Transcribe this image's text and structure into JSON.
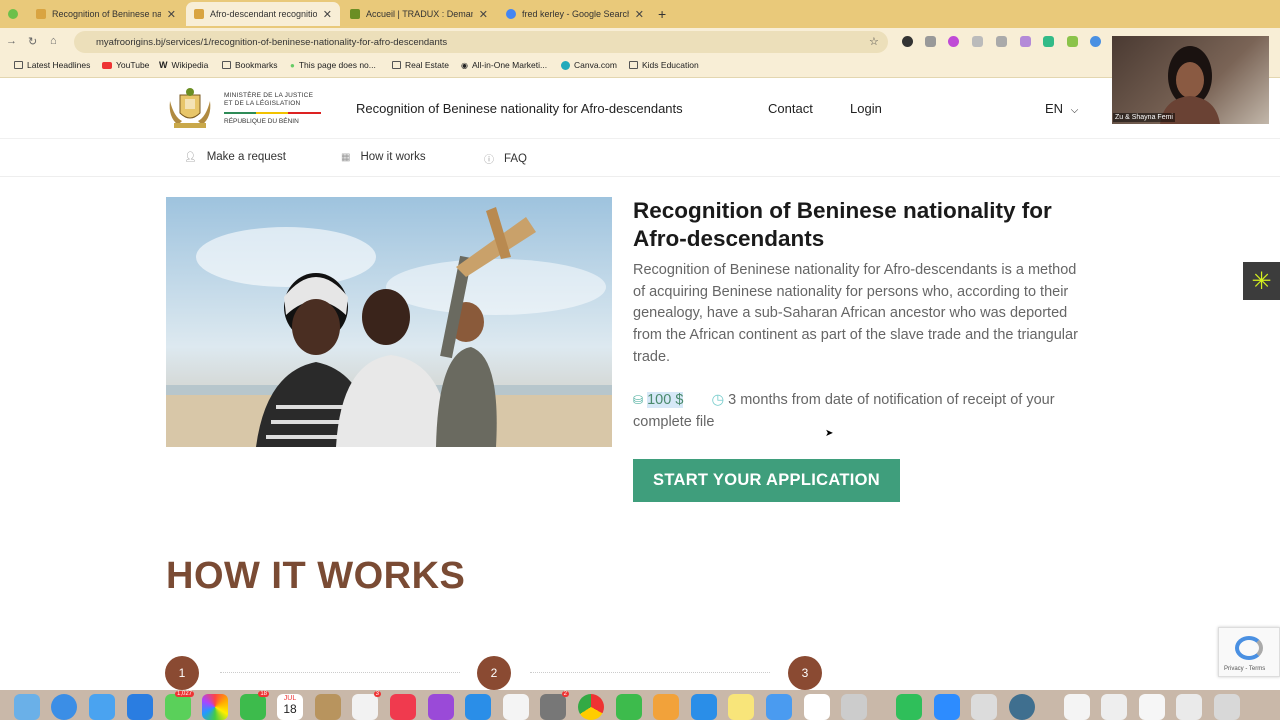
{
  "browser": {
    "tabs": [
      {
        "label": "Recognition of Beninese nati",
        "active": false,
        "fav_color": "#d9a441"
      },
      {
        "label": "Afro-descendant recognition",
        "active": true,
        "fav_color": "#d9a441"
      },
      {
        "label": "Accueil | TRADUX : Demande",
        "active": false,
        "fav_color": "#6b8e23"
      },
      {
        "label": "fred kerley - Google Search",
        "active": false,
        "fav_color": "#4285f4"
      }
    ],
    "url": "myafroorigins.bj/services/1/recognition-of-beninese-nationality-for-afro-descendants",
    "bookmarks": [
      {
        "label": "Latest Headlines",
        "icon": "folder-icon"
      },
      {
        "label": "YouTube",
        "icon": "youtube-icon"
      },
      {
        "label": "Wikipedia",
        "icon": "wikipedia-icon"
      },
      {
        "label": "Bookmarks",
        "icon": "folder-icon"
      },
      {
        "label": "This page does no...",
        "icon": "page-icon"
      },
      {
        "label": "Real Estate",
        "icon": "folder-icon"
      },
      {
        "label": "All-in-One Marketi...",
        "icon": "page-icon"
      },
      {
        "label": "Canva.com",
        "icon": "canva-icon"
      },
      {
        "label": "Kids Education",
        "icon": "folder-icon"
      }
    ]
  },
  "site": {
    "logo_line1": "MINISTÈRE DE LA JUSTICE",
    "logo_line2": "ET DE LA LÉGISLATION",
    "logo_sub": "RÉPUBLIQUE DU BÉNIN",
    "nav": {
      "service": "Recognition of Beninese nationality for Afro-descendants",
      "contact": "Contact",
      "login": "Login",
      "lang": "EN"
    },
    "subnav": {
      "request": "Make a request",
      "how": "How it works",
      "faq": "FAQ"
    }
  },
  "main": {
    "title": "Recognition of Beninese nationality for Afro-descendants",
    "description": "Recognition of Beninese nationality for Afro-descendants is a method of acquiring Beninese nationality for persons who, according to their genealogy, have a sub-Saharan African ancestor who was deported from the African continent as part of the slave trade and the triangular trade.",
    "price": "100 $",
    "duration": "3 months from date of notification of receipt of your complete file",
    "cta": "START YOUR APPLICATION",
    "how_title": "HOW IT WORKS",
    "steps": [
      "1",
      "2",
      "3"
    ]
  },
  "video_call": {
    "participant": "Zu & Shayna Femi"
  },
  "recaptcha": {
    "text": "Privacy - Terms"
  },
  "dock": {
    "badges": {
      "mail": "1,027",
      "facetime": "18",
      "calendar_month": "JUL",
      "calendar_day": "18",
      "reminders": "3",
      "settings": "2"
    }
  }
}
